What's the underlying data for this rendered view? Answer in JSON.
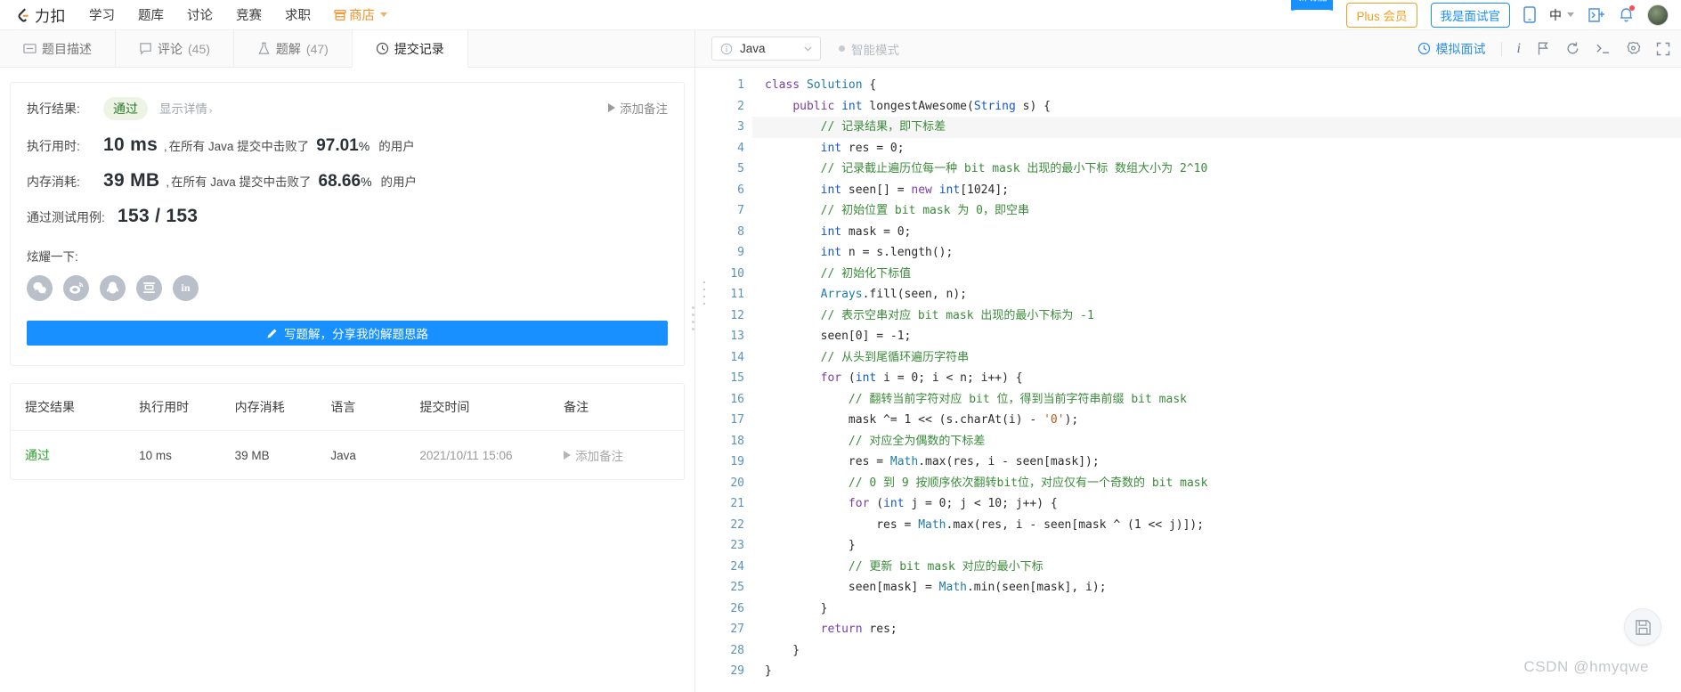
{
  "topnav": {
    "brand": "力扣",
    "links": [
      {
        "label": "学习",
        "icon": ""
      },
      {
        "label": "题库",
        "icon": ""
      },
      {
        "label": "讨论",
        "icon": ""
      },
      {
        "label": "竞赛",
        "icon": ""
      },
      {
        "label": "求职",
        "icon": ""
      }
    ],
    "shop": {
      "label": "商店",
      "icon": "store-icon"
    },
    "ribbon_label": "新功能",
    "plus_label": "Plus 会员",
    "interviewer_label": "我是面试官",
    "mobile_icon": "mobile-icon",
    "lang": "中",
    "console_icon": "console-add-icon",
    "bell_icon": "bell-icon",
    "avatar": "user-avatar"
  },
  "tabs": [
    {
      "label": "题目描述",
      "icon": "description-icon",
      "count": ""
    },
    {
      "label": "评论",
      "icon": "comment-icon",
      "count": "(45)"
    },
    {
      "label": "题解",
      "icon": "flask-icon",
      "count": "(47)"
    },
    {
      "label": "提交记录",
      "icon": "clock-icon",
      "count": ""
    }
  ],
  "active_tab_index": 3,
  "result": {
    "exec_result_label": "执行结果:",
    "status": "通过",
    "show_detail": "显示详情",
    "show_detail_chevron": "›",
    "add_note": "添加备注",
    "runtime_label": "执行用时:",
    "runtime_value": "10 ms",
    "runtime_mid": "在所有 Java 提交中击败了",
    "runtime_pct": "97.01",
    "pct_symbol": "%",
    "runtime_tail": "的用户",
    "memory_label": "内存消耗:",
    "memory_value": "39 MB",
    "memory_mid": "在所有 Java 提交中击败了",
    "memory_pct": "68.66",
    "memory_tail": "的用户",
    "testcases_label": "通过测试用例:",
    "testcases_value": "153 / 153",
    "comma": ",",
    "brag_label": "炫耀一下:",
    "socials": [
      {
        "name": "wechat-icon"
      },
      {
        "name": "weibo-icon"
      },
      {
        "name": "qq-icon"
      },
      {
        "name": "douban-icon"
      },
      {
        "name": "linkedin-icon"
      }
    ],
    "write_button": "写题解，分享我的解题思路",
    "write_button_icon": "pencil-icon"
  },
  "submissions_table": {
    "headers": [
      "提交结果",
      "执行用时",
      "内存消耗",
      "语言",
      "提交时间",
      "备注"
    ],
    "rows": [
      {
        "status": "通过",
        "runtime": "10 ms",
        "memory": "39 MB",
        "language": "Java",
        "time": "2021/10/11 15:06",
        "note": "添加备注"
      }
    ]
  },
  "editor_toolbar": {
    "language": "Java",
    "language_info_icon": "info-circle-icon",
    "language_chevron_icon": "chevron-down-icon",
    "smart_mode": "智能模式",
    "mock_interview": "模拟面试",
    "mock_interview_icon": "clock-icon",
    "icons": [
      {
        "name": "info-italic-icon",
        "glyph": "i"
      },
      {
        "name": "flag-icon",
        "glyph": ""
      },
      {
        "name": "reset-icon",
        "glyph": ""
      },
      {
        "name": "console-icon",
        "glyph": ""
      },
      {
        "name": "settings-icon",
        "glyph": ""
      },
      {
        "name": "fullscreen-icon",
        "glyph": ""
      }
    ]
  },
  "editor": {
    "line_numbers": [
      1,
      2,
      3,
      4,
      5,
      6,
      7,
      8,
      9,
      10,
      11,
      12,
      13,
      14,
      15,
      16,
      17,
      18,
      19,
      20,
      21,
      22,
      23,
      24,
      25,
      26,
      27,
      28,
      29
    ],
    "code_lines": [
      "class Solution {",
      "    public int longestAwesome(String s) {",
      "        // 记录结果，即下标差",
      "        int res = 0;",
      "        // 记录截止遍历位每一种 bit mask 出现的最小下标 数组大小为 2^10",
      "        int seen[] = new int[1024];",
      "        // 初始位置 bit mask 为 0，即空串",
      "        int mask = 0;",
      "        int n = s.length();",
      "        // 初始化下标值",
      "        Arrays.fill(seen, n);",
      "        // 表示空串对应 bit mask 出现的最小下标为 -1",
      "        seen[0] = -1;",
      "        // 从头到尾循环遍历字符串",
      "        for (int i = 0; i < n; i++) {",
      "            // 翻转当前字符对应 bit 位，得到当前字符串前缀 bit mask",
      "            mask ^= 1 << (s.charAt(i) - '0');",
      "            // 对应全为偶数的下标差",
      "            res = Math.max(res, i - seen[mask]);",
      "            // 0 到 9 按顺序依次翻转bit位，对应仅有一个奇数的 bit mask",
      "            for (int j = 0; j < 10; j++) {",
      "                res = Math.max(res, i - seen[mask ^ (1 << j)]);",
      "            }",
      "            // 更新 bit mask 对应的最小下标",
      "            seen[mask] = Math.min(seen[mask], i);",
      "        }",
      "        return res;",
      "    }",
      "}"
    ],
    "save_icon": "save-icon",
    "watermark": "CSDN @hmyqwe"
  },
  "colors": {
    "accent_blue": "#1890ff",
    "orange": "#f0a020",
    "pass_green": "#2aa12a",
    "comment_green": "#3a8b3a",
    "keyword_purple": "#7a3ea3"
  }
}
